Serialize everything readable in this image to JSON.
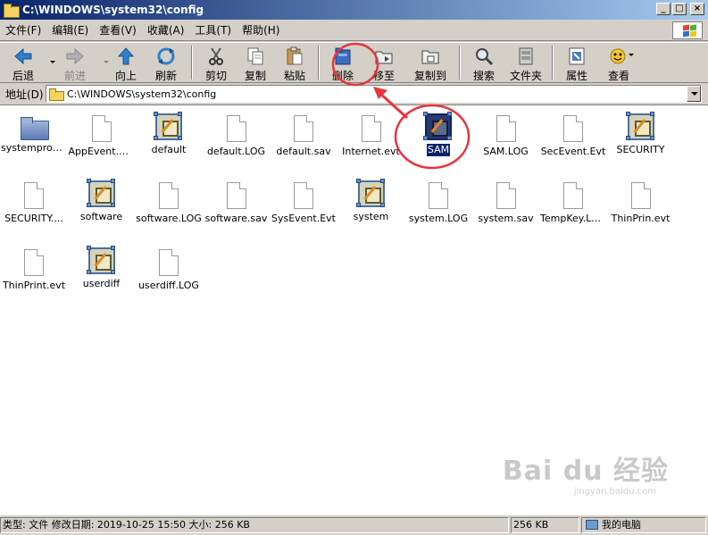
{
  "window": {
    "title": "C:\\WINDOWS\\system32\\config"
  },
  "menu": [
    {
      "label": "文件(F)"
    },
    {
      "label": "编辑(E)"
    },
    {
      "label": "查看(V)"
    },
    {
      "label": "收藏(A)"
    },
    {
      "label": "工具(T)"
    },
    {
      "label": "帮助(H)"
    }
  ],
  "toolbar": {
    "back": "后退",
    "forward": "前进",
    "up": "向上",
    "refresh": "刷新",
    "cut": "剪切",
    "copy": "复制",
    "paste": "粘贴",
    "delete": "删除",
    "move_to": "移至",
    "copy_to": "复制到",
    "search": "搜索",
    "folders": "文件夹",
    "properties": "属性",
    "views": "查看"
  },
  "address": {
    "label": "地址(D)",
    "value": "C:\\WINDOWS\\system32\\config"
  },
  "files": [
    {
      "name": "systemprofile",
      "type": "folder"
    },
    {
      "name": "AppEvent.Evt",
      "type": "doc"
    },
    {
      "name": "default",
      "type": "hive"
    },
    {
      "name": "default.LOG",
      "type": "doc"
    },
    {
      "name": "default.sav",
      "type": "doc"
    },
    {
      "name": "Internet.evt",
      "type": "doc"
    },
    {
      "name": "SAM",
      "type": "hive",
      "selected": true
    },
    {
      "name": "SAM.LOG",
      "type": "doc"
    },
    {
      "name": "SecEvent.Evt",
      "type": "doc"
    },
    {
      "name": "SECURITY",
      "type": "hive"
    },
    {
      "name": "SECURITY....",
      "type": "doc"
    },
    {
      "name": "software",
      "type": "hive"
    },
    {
      "name": "software.LOG",
      "type": "doc"
    },
    {
      "name": "software.sav",
      "type": "doc"
    },
    {
      "name": "SysEvent.Evt",
      "type": "doc"
    },
    {
      "name": "system",
      "type": "hive"
    },
    {
      "name": "system.LOG",
      "type": "doc"
    },
    {
      "name": "system.sav",
      "type": "doc"
    },
    {
      "name": "TempKey.LOG",
      "type": "doc"
    },
    {
      "name": "ThinPrin.evt",
      "type": "doc"
    },
    {
      "name": "ThinPrint.evt",
      "type": "doc"
    },
    {
      "name": "userdiff",
      "type": "hive"
    },
    {
      "name": "userdiff.LOG",
      "type": "doc"
    }
  ],
  "status": {
    "info": "类型: 文件 修改日期: 2019-10-25 15:50 大小: 256 KB",
    "size": "256 KB",
    "location": "我的电脑"
  },
  "watermark": {
    "brand": "Bai du 经验",
    "url": "jingyan.baidu.com"
  },
  "colors": {
    "titlebar_start": "#0a246a",
    "titlebar_end": "#a6caf0",
    "annotation": "#e8333a",
    "selection": "#0a246a"
  }
}
